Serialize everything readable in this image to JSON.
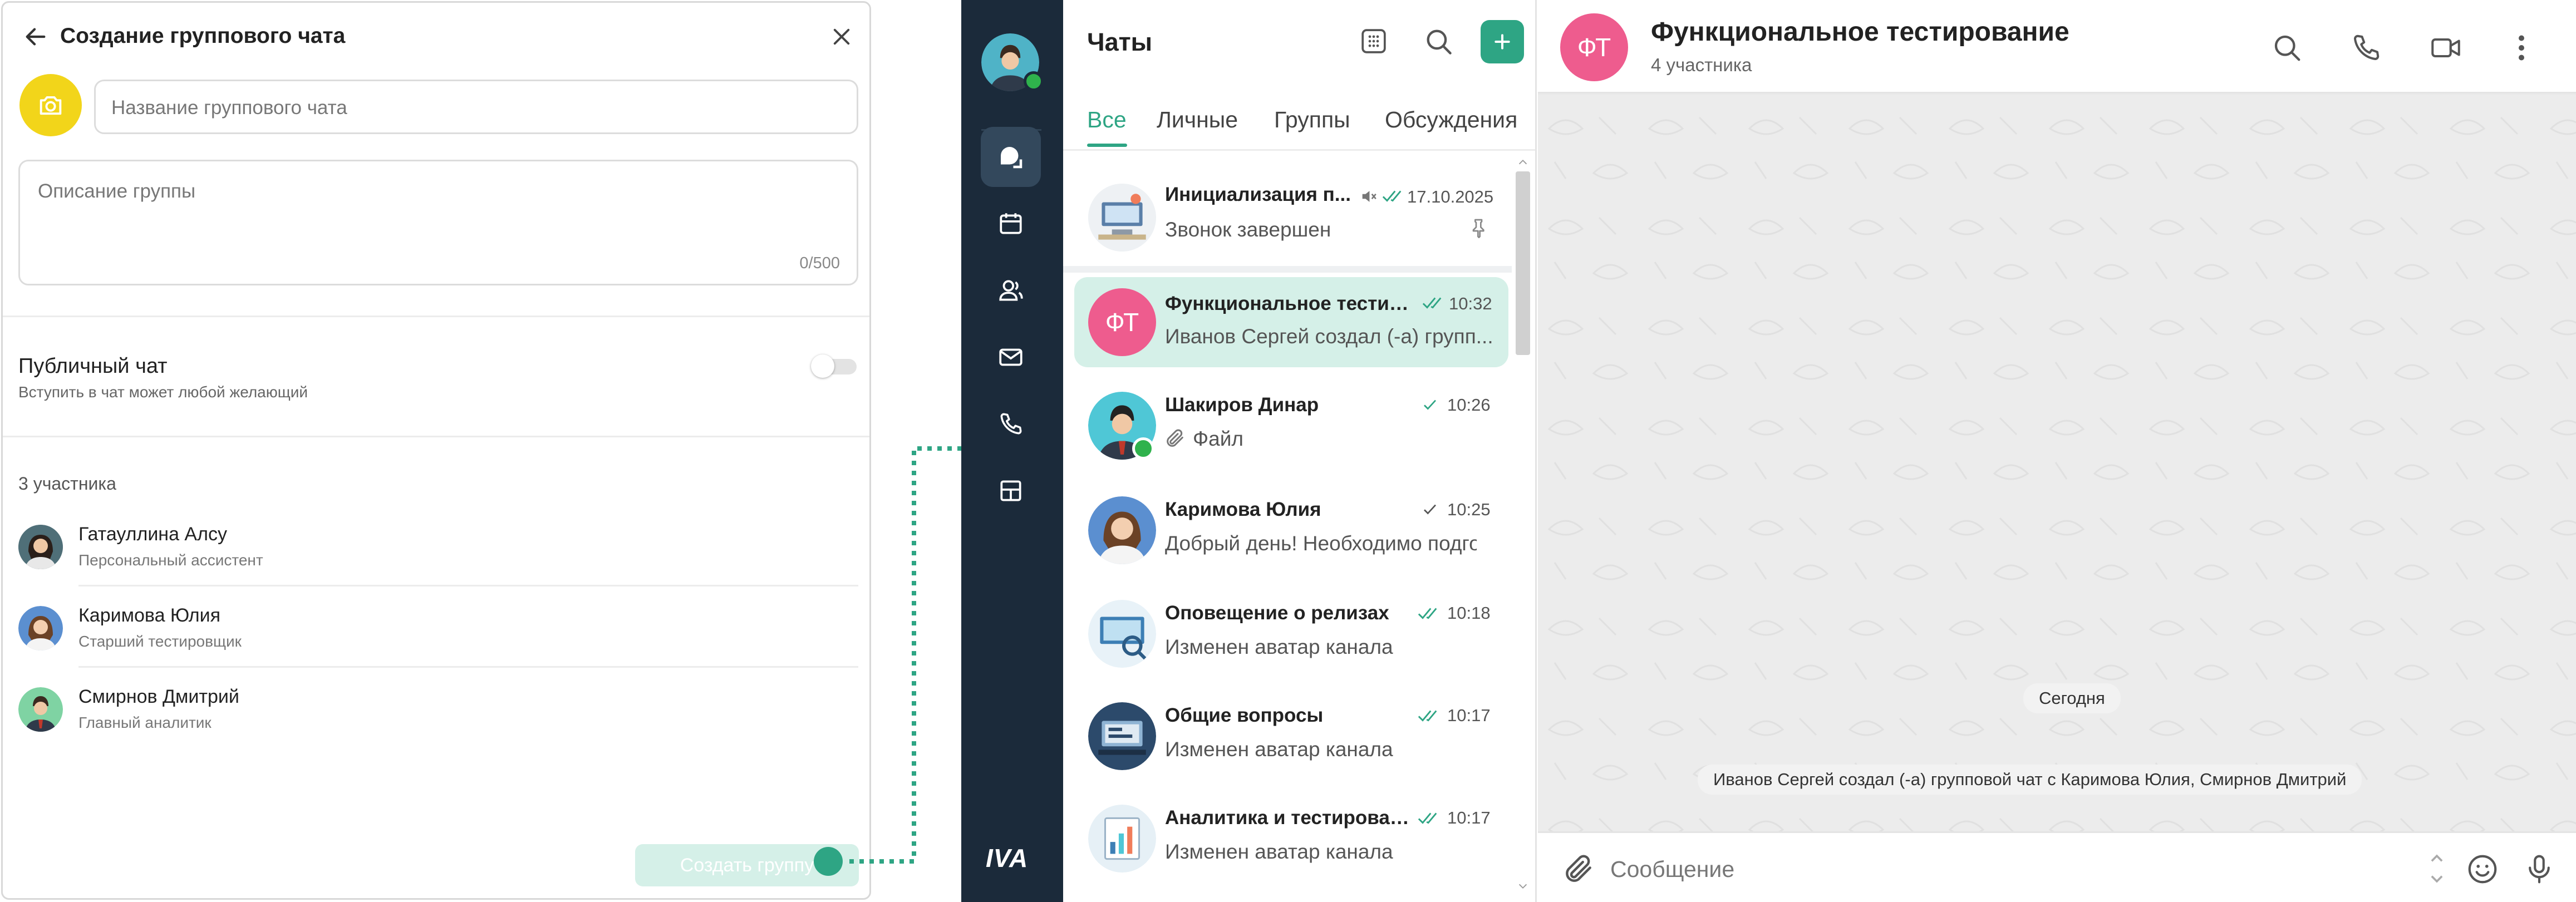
{
  "left_panel": {
    "title": "Создание группового чата",
    "name_placeholder": "Название группового чата",
    "description_placeholder": "Описание группы",
    "char_counter": "0/500",
    "public_chat_label": "Публичный чат",
    "public_chat_hint": "Вступить в чат может любой желающий",
    "public_chat_enabled": false,
    "members_count_label": "3 участника",
    "members": [
      {
        "name": "Гатауллина Алсу",
        "role": "Персональный ассистент"
      },
      {
        "name": "Каримова Юлия",
        "role": "Старший тестировщик"
      },
      {
        "name": "Смирнов Дмитрий",
        "role": "Главный аналитик"
      }
    ],
    "create_button": "Создать группу"
  },
  "rail": {
    "logo_text": "IVA",
    "items": [
      "chats-icon",
      "calendar-icon",
      "contacts-icon",
      "mail-icon",
      "phone-icon",
      "widgets-icon"
    ]
  },
  "chat_list": {
    "title": "Чаты",
    "tabs": [
      "Все",
      "Личные",
      "Группы",
      "Обсуждения"
    ],
    "active_tab": "Все",
    "items": [
      {
        "name": "Инициализация п...",
        "time": "17.10.2025",
        "preview": "Звонок завершен",
        "muted": true,
        "pinned": true
      },
      {
        "name": "Функциональное тестир...",
        "time": "10:32",
        "preview": "Иванов Сергей создал (-а) групп...",
        "initials": "ФТ",
        "active": true
      },
      {
        "name": "Шакиров Динар",
        "time": "10:26",
        "preview": "Файл"
      },
      {
        "name": "Каримова Юлия",
        "time": "10:25",
        "preview": "Добрый день! Необходимо подгот"
      },
      {
        "name": "Оповещение о релизах",
        "time": "10:18",
        "preview": "Изменен аватар канала"
      },
      {
        "name": "Общие вопросы",
        "time": "10:17",
        "preview": "Изменен аватар канала"
      },
      {
        "name": "Аналитика и тестирован...",
        "time": "10:17",
        "preview": "Изменен аватар канала"
      }
    ]
  },
  "conversation": {
    "title": "Функциональное тестирование",
    "subtitle": "4 участника",
    "initials": "ФТ",
    "date_pill": "Сегодня",
    "system_message": "Иванов Сергей создал (-а) групповой чат с Каримова Юлия, Смирнов Дмитрий",
    "message_placeholder": "Сообщение"
  },
  "colors": {
    "accent": "#2ea584",
    "accent_light": "#d5f0e8",
    "avatar_pink": "#ee5c8e",
    "rail_bg": "#1b2a3a",
    "yellow": "#f2d51a"
  }
}
